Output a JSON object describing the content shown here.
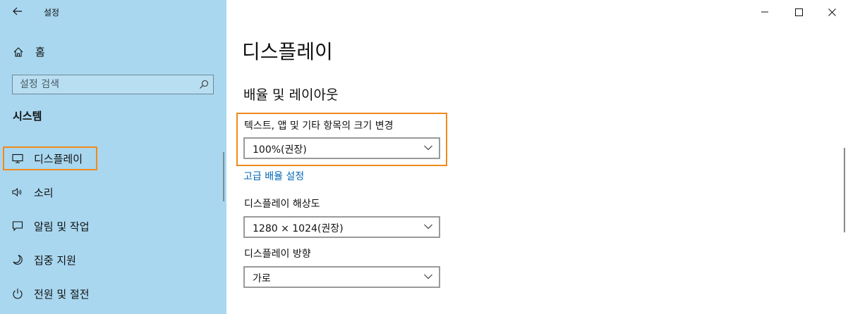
{
  "window": {
    "title": "설정",
    "back_icon": "back-arrow-icon",
    "minimize_icon": "minimize-icon",
    "maximize_icon": "maximize-icon",
    "close_icon": "close-icon"
  },
  "sidebar": {
    "home_label": "홈",
    "search_placeholder": "설정 검색",
    "section_title": "시스템",
    "items": [
      {
        "label": "디스플레이",
        "icon": "monitor-icon",
        "selected": true
      },
      {
        "label": "소리",
        "icon": "speaker-icon",
        "selected": false
      },
      {
        "label": "알림 및 작업",
        "icon": "notification-icon",
        "selected": false
      },
      {
        "label": "집중 지원",
        "icon": "moon-icon",
        "selected": false
      },
      {
        "label": "전원 및 절전",
        "icon": "power-icon",
        "selected": false
      }
    ]
  },
  "main": {
    "page_title": "디스플레이",
    "section_title": "배율 및 레이아웃",
    "scale_label": "텍스트, 앱 및 기타 항목의 크기 변경",
    "scale_value": "100%(권장)",
    "advanced_link": "고급 배율 설정",
    "resolution_label": "디스플레이 해상도",
    "resolution_value": "1280 × 1024(권장)",
    "orientation_label": "디스플레이 방향",
    "orientation_value": "가로"
  },
  "colors": {
    "sidebar_bg": "#a9d7ef",
    "highlight": "#f08a1c",
    "link": "#0067b8"
  }
}
